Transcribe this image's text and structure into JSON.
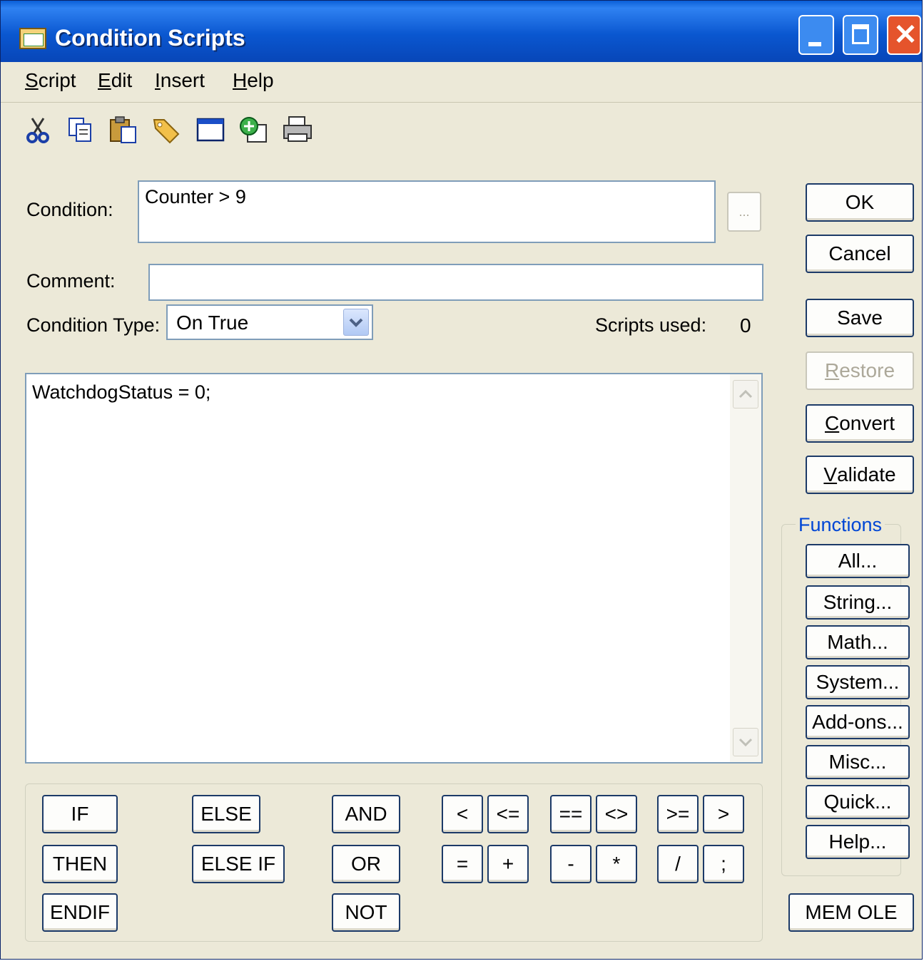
{
  "window": {
    "title": "Condition Scripts"
  },
  "menu": {
    "items": [
      {
        "label": "Script",
        "accel": "S",
        "rest": "cript"
      },
      {
        "label": "Edit",
        "accel": "E",
        "rest": "dit"
      },
      {
        "label": "Insert",
        "accel": "I",
        "rest": "nsert"
      },
      {
        "label": "Help",
        "accel": "H",
        "rest": "elp"
      }
    ]
  },
  "toolbar": {
    "icons": [
      "cut-icon",
      "copy-icon",
      "paste-icon",
      "tag-icon",
      "window-icon",
      "insert-icon",
      "print-icon"
    ]
  },
  "form": {
    "condition_label": "Condition:",
    "condition_value": "Counter > 9",
    "browse_label": "...",
    "comment_label": "Comment:",
    "comment_value": "",
    "condition_type_label": "Condition Type:",
    "condition_type_value": "On True",
    "scripts_used_label": "Scripts used:",
    "scripts_used_value": "0"
  },
  "editor": {
    "text": "WatchdogStatus = 0;"
  },
  "buttons": {
    "ok": "OK",
    "cancel": "Cancel",
    "save": "Save",
    "restore": {
      "accel": "R",
      "rest": "estore"
    },
    "convert": {
      "accel": "C",
      "rest": "onvert"
    },
    "validate": {
      "accel": "V",
      "rest": "alidate"
    },
    "mem_ole": "MEM OLE"
  },
  "functions": {
    "title": "Functions",
    "items": [
      "All...",
      "String...",
      "Math...",
      "System...",
      "Add-ons...",
      "Misc...",
      "Quick...",
      "Help..."
    ]
  },
  "operators": {
    "keywords": [
      "IF",
      "THEN",
      "ENDIF",
      "ELSE",
      "ELSE IF",
      "AND",
      "OR",
      "NOT"
    ],
    "symbols": [
      "<",
      "<=",
      "==",
      "<>",
      ">=",
      ">",
      "=",
      "+",
      "-",
      "*",
      "/",
      ";"
    ]
  },
  "colors": {
    "title_bar": "#0a5fd8",
    "dialog_bg": "#ece9d8",
    "functions_label": "#0046d5",
    "close_button": "#e5542c"
  }
}
